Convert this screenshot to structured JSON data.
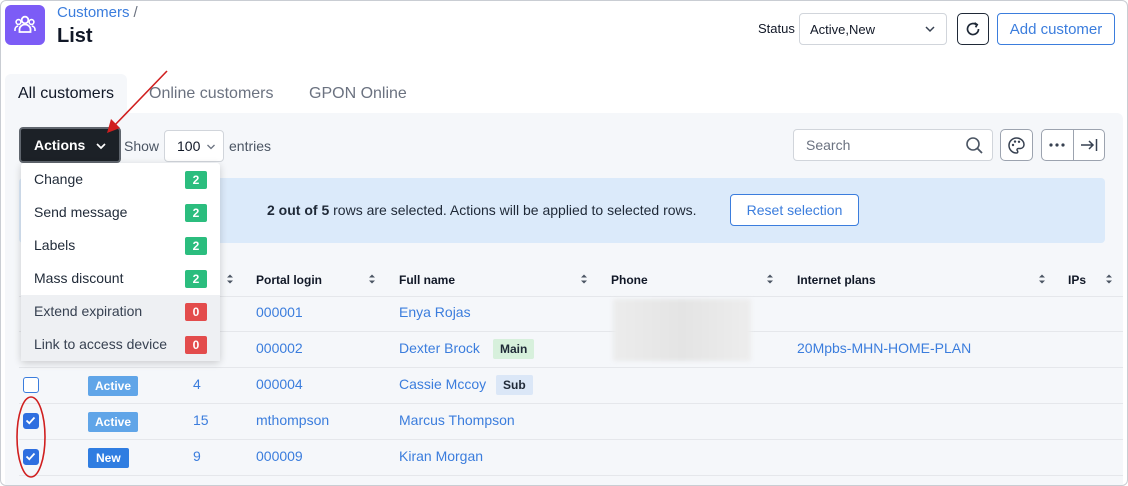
{
  "header": {
    "breadcrumb": "Customers",
    "breadcrumb_sep": "/",
    "title": "List",
    "status_label": "Status",
    "status_value": "Active,New",
    "add_customer": "Add customer"
  },
  "tabs": [
    {
      "label": "All customers",
      "active": true
    },
    {
      "label": "Online customers",
      "active": false
    },
    {
      "label": "GPON Online",
      "active": false
    }
  ],
  "toolbar": {
    "actions_label": "Actions",
    "show_label": "Show",
    "entries_value": "100",
    "entries_label": "entries",
    "search_placeholder": "Search"
  },
  "actions_menu": [
    {
      "label": "Change",
      "count": "2",
      "color": "#2bbd7e"
    },
    {
      "label": "Send message",
      "count": "2",
      "color": "#2bbd7e"
    },
    {
      "label": "Labels",
      "count": "2",
      "color": "#2bbd7e"
    },
    {
      "label": "Mass discount",
      "count": "2",
      "color": "#2bbd7e"
    },
    {
      "label": "Extend expiration",
      "count": "0",
      "color": "#e34c4c"
    },
    {
      "label": "Link to access device",
      "count": "0",
      "color": "#e34c4c"
    }
  ],
  "selection_banner": {
    "selected": "2",
    "out_of_text": " out of ",
    "total": "5",
    "rest_text": " rows are selected. Actions will be applied to selected rows.",
    "reset_label": "Reset selection"
  },
  "table": {
    "columns": [
      "Portal login",
      "Full name",
      "Phone",
      "Internet plans",
      "IPs"
    ],
    "rows": [
      {
        "checked": null,
        "status": "",
        "id": "",
        "login": "000001",
        "name": "Enya Rojas",
        "tag": "",
        "plan": ""
      },
      {
        "checked": null,
        "status": "",
        "id": "",
        "login": "000002",
        "name": "Dexter Brock",
        "tag": "Main",
        "plan": "20Mpbs-MHN-HOME-PLAN"
      },
      {
        "checked": false,
        "status": "Active",
        "id": "4",
        "login": "000004",
        "name": "Cassie Mccoy",
        "tag": "Sub",
        "plan": ""
      },
      {
        "checked": true,
        "status": "Active",
        "id": "15",
        "login": "mthompson",
        "name": "Marcus Thompson",
        "tag": "",
        "plan": ""
      },
      {
        "checked": true,
        "status": "New",
        "id": "9",
        "login": "000009",
        "name": "Kiran Morgan",
        "tag": "",
        "plan": ""
      }
    ]
  },
  "colors": {
    "accent": "#3b7ddd",
    "brand_icon_bg": "#7c5cf6",
    "annotation": "#d01f1f"
  }
}
